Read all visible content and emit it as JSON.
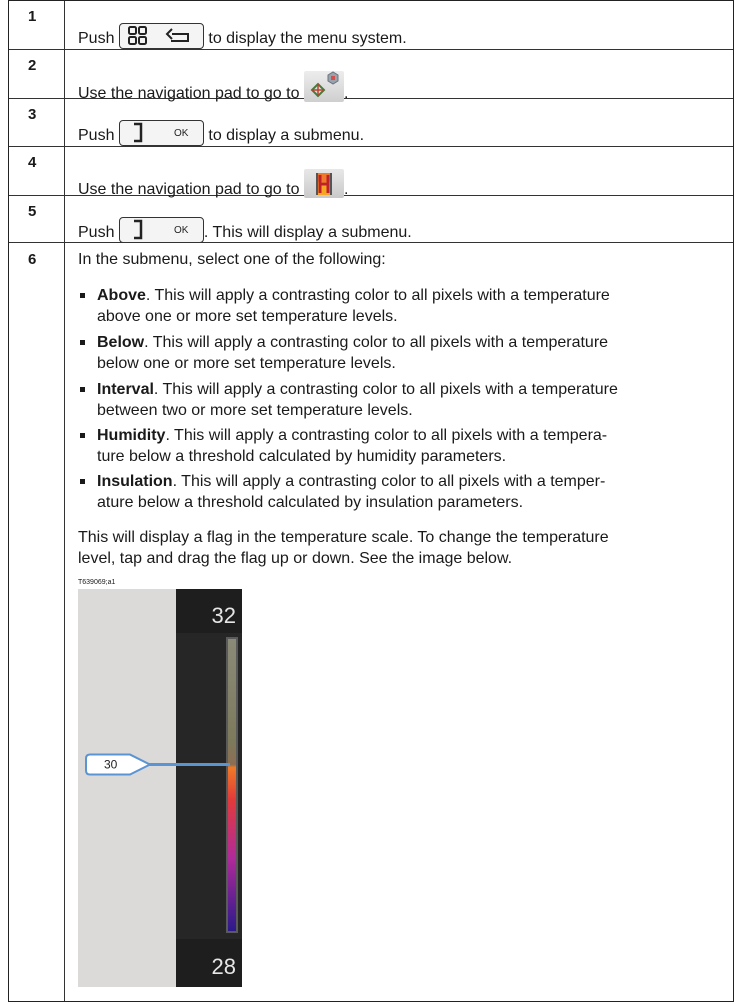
{
  "steps": [
    {
      "num": "1",
      "pre": "Push ",
      "post": " to display the menu system.",
      "icon": "menu-back-key-icon"
    },
    {
      "num": "2",
      "pre": "Use the navigation pad to go to ",
      "post": ".",
      "icon": "color-menu-icon"
    },
    {
      "num": "3",
      "pre": "Push ",
      "post": " to display a submenu.",
      "icon": "ok-key-icon"
    },
    {
      "num": "4",
      "pre": "Use the navigation pad to go to ",
      "post": ".",
      "icon": "color-alarm-icon"
    },
    {
      "num": "5",
      "pre": "Push ",
      "post": ". This will display a submenu.",
      "icon": "ok-key-icon"
    }
  ],
  "step6": {
    "num": "6",
    "intro": "In the submenu, select one of the following:",
    "bullets": [
      {
        "term": "Above",
        "lines": [
          ". This will apply a contrasting color to all pixels with a temperature",
          "above one or more set temperature levels."
        ]
      },
      {
        "term": "Below",
        "lines": [
          ". This will apply a contrasting color to all pixels with a temperature",
          "below one or more set temperature levels."
        ]
      },
      {
        "term": "Interval",
        "lines": [
          ". This will apply a contrasting color to all pixels with a temperature",
          "between two or more set temperature levels."
        ]
      },
      {
        "term": "Humidity",
        "lines": [
          ". This will apply a contrasting color to all pixels with a tempera-",
          "ture below a threshold calculated by humidity parameters."
        ]
      },
      {
        "term": "Insulation",
        "lines": [
          ". This will apply a contrasting color to all pixels with a temper-",
          "ature below a threshold calculated by insulation parameters."
        ]
      }
    ],
    "para1": "This will display a flag in the temperature scale. To change the temperature",
    "para2": "level, tap and drag the flag up or down. See the image below.",
    "image_ref": "T639069;a1",
    "scale": {
      "top": "32",
      "bottom": "28",
      "flag": "30",
      "flag_level": 0.43
    }
  },
  "key_labels": {
    "ok": "OK"
  },
  "colors": {
    "scale_bg": "#262626",
    "flag_line": "#5b94d3",
    "hot": "#e8452b",
    "cold": "#3a1a8a"
  }
}
